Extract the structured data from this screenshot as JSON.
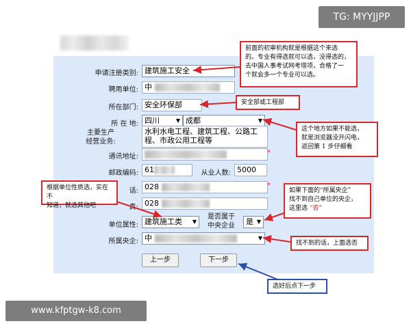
{
  "badges": {
    "top_right": "TG: MYYJJPP",
    "bottom_left": "www.kfptgw-k8.com"
  },
  "form": {
    "category": {
      "label": "申请注册类别:",
      "value": "建筑施工安全"
    },
    "employer": {
      "label": "聘用单位:",
      "value": "中"
    },
    "department": {
      "label": "所在部门:",
      "value": "安全环保部"
    },
    "location": {
      "label": "所 在 地:",
      "province": "四川",
      "city": "成都"
    },
    "business": {
      "label_line1": "主要生产",
      "label_line2": "经营业务:",
      "value_line1": "水利水电工程、建筑工程、公路工",
      "value_line2": "程、市政公用工程等"
    },
    "address": {
      "label": "通讯地址:"
    },
    "postcode": {
      "label": "邮政编码:",
      "value": "61"
    },
    "staff_count": {
      "label": "从业人数:",
      "value": "5000"
    },
    "phone": {
      "label_tail": "话:",
      "value": "028"
    },
    "fax": {
      "label_tail": "真:",
      "value": "028"
    },
    "unit_type": {
      "label": "单位属性:",
      "value": "建筑施工类"
    },
    "is_central": {
      "label_line1": "是否属于",
      "label_line2": "中央企业",
      "value": "是"
    },
    "central_enterprise": {
      "label": "所属央企:",
      "value": "中"
    },
    "required_mark": "*",
    "buttons": {
      "prev": "上一步",
      "next": "下一步"
    }
  },
  "notes": {
    "top": [
      "前面的初审机构就是根据这个来选",
      "的。专业有得选就可以选，没得选的，",
      "去中国人事考试网考增项，合格了一",
      "个就会多一个专业可以选。"
    ],
    "dept": "安全部或工程部",
    "location": [
      "这个地方如果不能选，",
      "就是浏览器没开闪电，",
      "返回第 1 步仔细看"
    ],
    "unit_type": [
      "根据单位性质选，实在不",
      "知道，就选其他吧"
    ],
    "central_pre": [
      "如果下面的“所属央企”",
      "找不到自己单位的央企，",
      "这里选 "
    ],
    "central_no": "“否”",
    "central_missing": "找不到的话，上面选否",
    "next_step": "选好后点下一步"
  },
  "colors": {
    "panel": "#dce9fa",
    "red_note": "#d8262b",
    "blue_note": "#2a4fa8"
  }
}
